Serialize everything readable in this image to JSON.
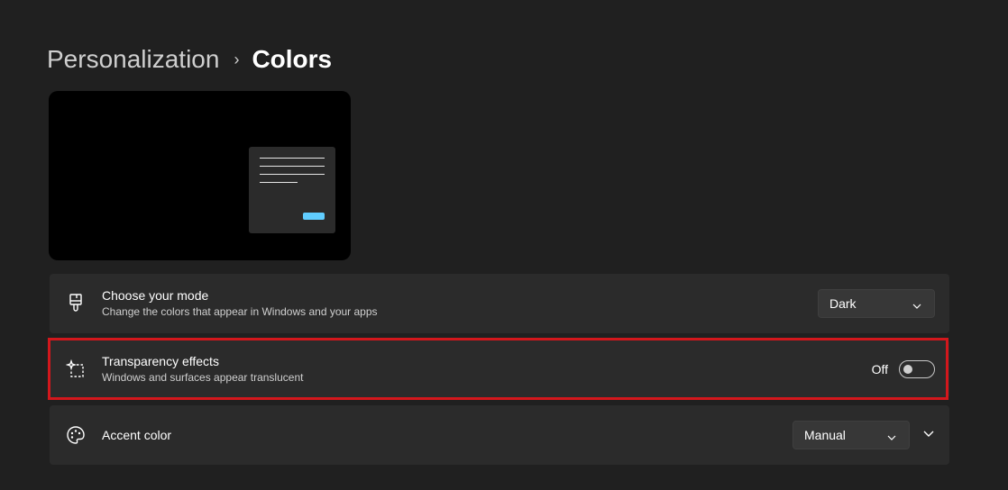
{
  "breadcrumb": {
    "parent": "Personalization",
    "separator": "›",
    "current": "Colors"
  },
  "preview": {
    "background": "#000000",
    "window_color": "#2b2b2b",
    "accent": "#60cdff"
  },
  "mode_card": {
    "icon": "paintbrush-icon",
    "title": "Choose your mode",
    "description": "Change the colors that appear in Windows and your apps",
    "selected": "Dark"
  },
  "transparency_card": {
    "icon": "transparency-sparkle-icon",
    "title": "Transparency effects",
    "description": "Windows and surfaces appear translucent",
    "toggle_label": "Off",
    "toggle_on": false,
    "highlight_color": "#d3171c"
  },
  "accent_card": {
    "icon": "palette-icon",
    "title": "Accent color",
    "selected": "Manual",
    "expand_icon": "chevron-down-icon"
  }
}
